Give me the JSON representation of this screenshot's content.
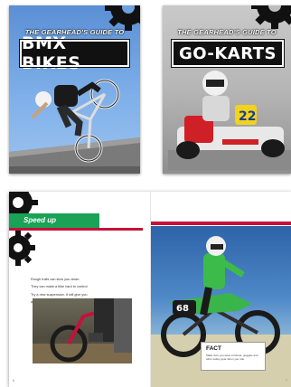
{
  "covers": [
    {
      "series": "THE GEARHEAD'S GUIDE TO",
      "title": "BMX BIKES"
    },
    {
      "series": "THE GEARHEAD'S GUIDE TO",
      "title": "GO-KARTS"
    }
  ],
  "kart_number": "22",
  "spread": {
    "heading": "Speed up",
    "body_lines": [
      "Rough trails can slow you down.",
      "They can make a bike hard to control.",
      "Try a new suspension. It will give you",
      "a smoother ride. It cuts down on"
    ],
    "body_trail": "traction too.",
    "bike_number": "68",
    "fact_label": "FACT",
    "fact_text": "Make sure you wear a helmet, goggles and other safety gear when you ride.",
    "folio_left": "6",
    "folio_right": "7"
  },
  "colors": {
    "accent_green": "#1aa257",
    "accent_red": "#c4123a",
    "bmx_sky": "#6fa1e0",
    "gear_black": "#111111"
  }
}
